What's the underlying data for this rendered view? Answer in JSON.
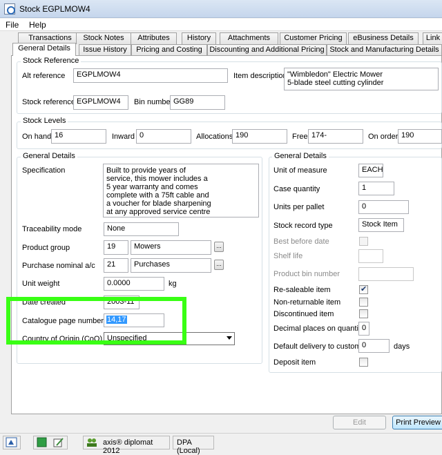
{
  "window": {
    "title": "Stock EGPLMOW4"
  },
  "menu": {
    "file": "File",
    "help": "Help"
  },
  "tabs_row1": [
    "Transactions",
    "Stock Notes",
    "Attributes",
    "History",
    "Attachments",
    "Customer Pricing",
    "eBusiness Details",
    "Link"
  ],
  "tabs_row2": [
    "General Details",
    "Issue History",
    "Pricing and Costing",
    "Discounting and Additional Pricing",
    "Stock and Manufacturing Details"
  ],
  "stock_reference": {
    "group_title": "Stock Reference",
    "alt_reference_label": "Alt reference",
    "alt_reference_value": "EGPLMOW4",
    "item_description_label": "Item description",
    "item_description_value": "\"Wimbledon\" Electric Mower\n5-blade steel cutting cylinder",
    "stock_reference_label": "Stock reference",
    "stock_reference_value": "EGPLMOW4",
    "bin_number_label": "Bin number",
    "bin_number_value": "GG89"
  },
  "stock_levels": {
    "group_title": "Stock Levels",
    "on_hand_label": "On hand",
    "on_hand_value": "16",
    "inward_label": "Inward",
    "inward_value": "0",
    "allocations_label": "Allocations",
    "allocations_value": "190",
    "free_label": "Free",
    "free_value": "174-",
    "on_order_label": "On order",
    "on_order_value": "190"
  },
  "general_left": {
    "group_title": "General Details",
    "specification_label": "Specification",
    "specification_value": "Built to provide years of\nservice, this mower includes a\n5 year warranty and comes\ncomplete with a 75ft cable and\na voucher for blade sharpening\nat any approved service centre",
    "traceability_label": "Traceability mode",
    "traceability_value": "None",
    "product_group_label": "Product group",
    "product_group_code": "19",
    "product_group_name": "Mowers",
    "purchase_nominal_label": "Purchase nominal a/c",
    "purchase_nominal_code": "21",
    "purchase_nominal_name": "Purchases",
    "unit_weight_label": "Unit weight",
    "unit_weight_value": "0.0000",
    "unit_weight_unit": "kg",
    "date_created_label": "Date created",
    "date_created_value": "2003-11",
    "catalogue_label": "Catalogue page number(s)",
    "catalogue_value": "14,17",
    "country_label": "Country of Origin (CoO)",
    "country_value": "Unspecified",
    "ellipsis": "..."
  },
  "general_right": {
    "group_title": "General Details",
    "unit_of_measure_label": "Unit of measure",
    "unit_of_measure_value": "EACH",
    "case_quantity_label": "Case quantity",
    "case_quantity_value": "1",
    "units_per_pallet_label": "Units per pallet",
    "units_per_pallet_value": "0",
    "stock_record_type_label": "Stock record type",
    "stock_record_type_value": "Stock Item",
    "best_before_label": "Best before date",
    "shelf_life_label": "Shelf life",
    "product_bin_label": "Product bin number",
    "resaleable_label": "Re-saleable item",
    "non_returnable_label": "Non-returnable item",
    "discontinued_label": "Discontinued item",
    "decimal_places_label": "Decimal places on quantity",
    "decimal_places_value": "0",
    "default_delivery_label": "Default delivery to customer",
    "default_delivery_value": "0",
    "days_label": "days",
    "deposit_label": "Deposit item"
  },
  "buttons": {
    "edit": "Edit",
    "print_preview": "Print Preview"
  },
  "statusbar": {
    "app_name": "axis® diplomat 2012",
    "company": "DPA (Local)"
  },
  "highlight_color": "#39ff14"
}
